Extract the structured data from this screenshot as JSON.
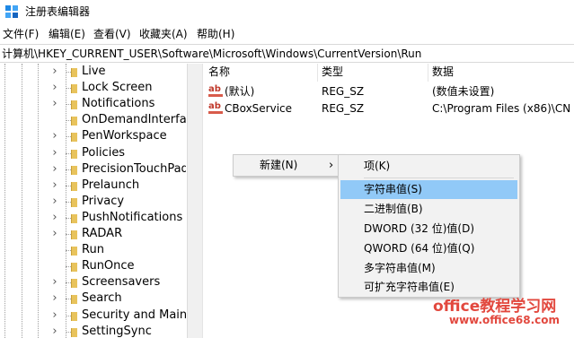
{
  "window": {
    "title": "注册表编辑器",
    "icon": "registry-editor-icon"
  },
  "menu": [
    "文件(F)",
    "编辑(E)",
    "查看(V)",
    "收藏夹(A)",
    "帮助(H)"
  ],
  "address": "计算机\\HKEY_CURRENT_USER\\Software\\Microsoft\\Windows\\CurrentVersion\\Run",
  "tree": {
    "items": [
      {
        "label": "Live",
        "expandable": true
      },
      {
        "label": "Lock Screen",
        "expandable": true
      },
      {
        "label": "Notifications",
        "expandable": true
      },
      {
        "label": "OnDemandInterfac",
        "expandable": false
      },
      {
        "label": "PenWorkspace",
        "expandable": true
      },
      {
        "label": "Policies",
        "expandable": true
      },
      {
        "label": "PrecisionTouchPad",
        "expandable": true
      },
      {
        "label": "Prelaunch",
        "expandable": true
      },
      {
        "label": "Privacy",
        "expandable": true
      },
      {
        "label": "PushNotifications",
        "expandable": true
      },
      {
        "label": "RADAR",
        "expandable": true
      },
      {
        "label": "Run",
        "expandable": false,
        "selected": true
      },
      {
        "label": "RunOnce",
        "expandable": false
      },
      {
        "label": "Screensavers",
        "expandable": true
      },
      {
        "label": "Search",
        "expandable": true
      },
      {
        "label": "Security and Maint",
        "expandable": true
      },
      {
        "label": "SettingSync",
        "expandable": true
      }
    ]
  },
  "list": {
    "columns": [
      "名称",
      "类型",
      "数据"
    ],
    "rows": [
      {
        "name": "(默认)",
        "type": "REG_SZ",
        "data": "(数值未设置)",
        "icon": "string-value-icon"
      },
      {
        "name": "CBoxService",
        "type": "REG_SZ",
        "data": "C:\\Program Files (x86)\\CN",
        "icon": "string-value-icon"
      }
    ]
  },
  "context_menu": {
    "new_label": "新建(N)",
    "arrow": "›",
    "submenu": [
      {
        "label": "项(K)"
      },
      {
        "label": "字符串值(S)",
        "highlighted": true
      },
      {
        "label": "二进制值(B)"
      },
      {
        "label": "DWORD (32 位)值(D)"
      },
      {
        "label": "QWORD (64 位)值(Q)"
      },
      {
        "label": "多字符串值(M)"
      },
      {
        "label": "可扩充字符串值(E)"
      }
    ]
  },
  "watermark": {
    "title": "office教程学习网",
    "url": "www.office68.com"
  },
  "colors": {
    "highlight": "#91c9f7",
    "folder": "#e8c35c",
    "watermark": "#e2483e",
    "menu_bg": "#f2f2f2"
  }
}
